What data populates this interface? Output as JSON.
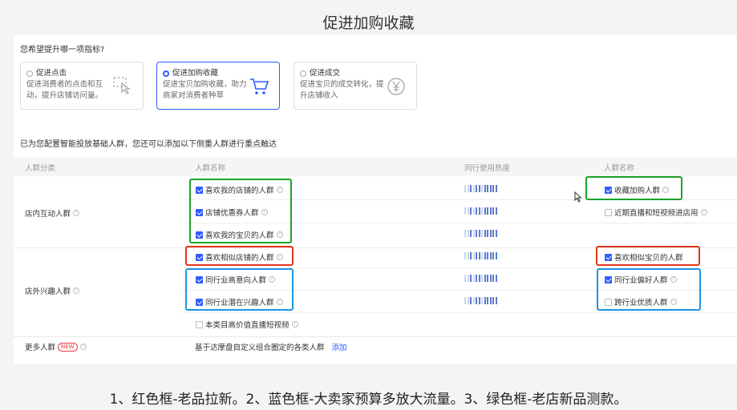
{
  "slide": {
    "title": "促进加购收藏",
    "caption": "1、红色框-老品拉新。2、蓝色框-大卖家预算多放大流量。3、绿色框-老店新品测款。"
  },
  "question": "您希望提升哪一项指标?",
  "options": [
    {
      "title": "促进点击",
      "desc": "促进消费者的点击和互动，提升店铺访问量。",
      "selected": false,
      "icon": "click-icon"
    },
    {
      "title": "促进加购收藏",
      "desc": "促进宝贝加购收藏，助力商家对消费者种草",
      "selected": true,
      "icon": "cart-icon"
    },
    {
      "title": "促进成交",
      "desc": "促进宝贝的成交转化，提升店铺收入",
      "selected": false,
      "icon": "yen-icon"
    }
  ],
  "hint": "已为您配置智能投放基础人群，您还可以添加以下侧重人群进行重点触达",
  "table": {
    "headers": [
      "人群分类",
      "人群名称",
      "同行使用热度",
      "人群名称"
    ],
    "categories": [
      {
        "label": "店内互动人群"
      },
      {
        "label": "店外兴趣人群"
      },
      {
        "label": "更多人群",
        "badge": "NEW"
      }
    ],
    "left_items": [
      {
        "label": "喜欢我的店铺的人群",
        "checked": true
      },
      {
        "label": "店铺优惠券人群",
        "checked": true
      },
      {
        "label": "喜欢我的宝贝的人群",
        "checked": true
      },
      {
        "label": "喜欢相似店铺的人群",
        "checked": true
      },
      {
        "label": "同行业高意向人群",
        "checked": true
      },
      {
        "label": "同行业潜在兴趣人群",
        "checked": true
      },
      {
        "label": "本类目高价值直播短视频",
        "checked": false
      }
    ],
    "right_items": [
      {
        "label": "收藏加购人群",
        "checked": true
      },
      {
        "label": "近期直播和短视频进店用",
        "checked": false
      },
      {
        "label": "喜欢相似宝贝的人群",
        "checked": true
      },
      {
        "label": "同行业偏好人群",
        "checked": true
      },
      {
        "label": "跨行业优质人群",
        "checked": false
      }
    ],
    "more_text": "基于达摩盘自定义组合圈定的各类人群",
    "more_link": "添加"
  },
  "colors": {
    "accent": "#2f5bff",
    "green_box": "#1aa32a",
    "red_box": "#e0361e",
    "blue_box": "#1d96e6"
  }
}
